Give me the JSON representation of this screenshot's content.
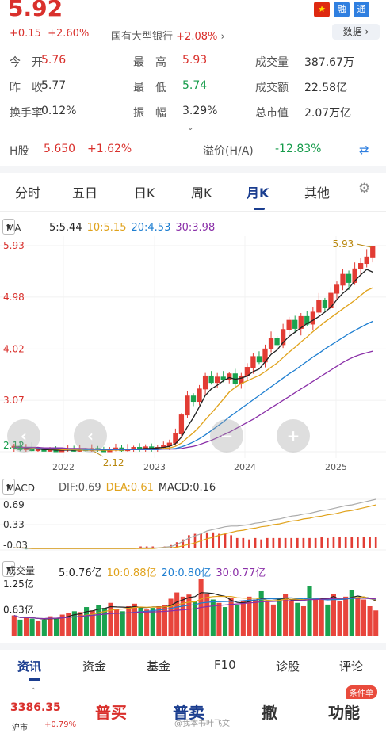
{
  "quote": {
    "price": "5.92",
    "change": "+0.15",
    "change_pct": "+2.60%",
    "sector_name": "国有大型银行",
    "sector_pct": "+2.08%",
    "badges": [
      "融",
      "通"
    ],
    "data_button": "数据"
  },
  "stats": [
    [
      {
        "label": "今　开",
        "value": "5.76",
        "color": "red"
      },
      {
        "label": "最　高",
        "value": "5.93",
        "color": "red"
      },
      {
        "label": "成交量",
        "value": "387.67万",
        "color": "grey"
      }
    ],
    [
      {
        "label": "昨　收",
        "value": "5.77",
        "color": "grey"
      },
      {
        "label": "最　低",
        "value": "5.74",
        "color": "green"
      },
      {
        "label": "成交额",
        "value": "22.58亿",
        "color": "grey"
      }
    ],
    [
      {
        "label": "换手率",
        "value": "0.12%",
        "color": "grey"
      },
      {
        "label": "振　幅",
        "value": "3.29%",
        "color": "grey"
      },
      {
        "label": "总市值",
        "value": "2.07万亿",
        "color": "grey"
      }
    ]
  ],
  "hshare": {
    "label": "H股",
    "price": "5.650",
    "pct": "+1.62%",
    "premium_label": "溢价(H/A)",
    "premium": "-12.83%"
  },
  "tabs": [
    "分时",
    "五日",
    "日K",
    "周K",
    "月K",
    "其他"
  ],
  "active_tab": "月K",
  "ma": {
    "selector": "MA",
    "items": [
      {
        "text": "5:5.44",
        "color": "#222222"
      },
      {
        "text": "10:5.15",
        "color": "#e0a21b"
      },
      {
        "text": "20:4.53",
        "color": "#1f7fd1"
      },
      {
        "text": "30:3.98",
        "color": "#8a2fa8"
      }
    ]
  },
  "chart_data": {
    "type": "candlestick",
    "interval": "monthly",
    "y_ticks": [
      "5.93",
      "4.98",
      "4.02",
      "3.07",
      "2.12"
    ],
    "ylim": [
      2.12,
      5.93
    ],
    "x_ticks": [
      "2022",
      "2023",
      "2024",
      "2025"
    ],
    "annotations": {
      "high": "5.93",
      "low": "2.12"
    },
    "zoom_controls": [
      "−",
      "+"
    ],
    "start_open": 2.2,
    "closes": [
      2.22,
      2.16,
      2.2,
      2.14,
      2.18,
      2.13,
      2.16,
      2.12,
      2.15,
      2.17,
      2.13,
      2.16,
      2.14,
      2.18,
      2.15,
      2.12,
      2.16,
      2.19,
      2.14,
      2.17,
      2.2,
      2.16,
      2.21,
      2.18,
      2.2,
      2.23,
      2.28,
      2.45,
      2.8,
      3.15,
      3.05,
      3.28,
      3.52,
      3.4,
      3.5,
      3.46,
      3.56,
      3.38,
      3.52,
      3.68,
      3.88,
      3.78,
      4.02,
      4.22,
      4.1,
      4.38,
      4.55,
      4.4,
      4.62,
      4.48,
      4.7,
      4.92,
      4.78,
      5.05,
      5.2,
      5.4,
      5.25,
      5.5,
      5.6,
      5.72,
      5.92
    ],
    "ma_lines": [
      {
        "name": "MA5",
        "color": "#222222",
        "values": [
          2.2,
          2.2,
          2.19,
          2.18,
          2.17,
          2.16,
          2.16,
          2.15,
          2.15,
          2.15,
          2.15,
          2.15,
          2.15,
          2.16,
          2.15,
          2.15,
          2.15,
          2.16,
          2.16,
          2.16,
          2.17,
          2.17,
          2.18,
          2.18,
          2.19,
          2.2,
          2.22,
          2.27,
          2.39,
          2.58,
          2.75,
          2.95,
          3.16,
          3.28,
          3.35,
          3.43,
          3.49,
          3.46,
          3.48,
          3.52,
          3.6,
          3.65,
          3.78,
          3.92,
          4.0,
          4.14,
          4.25,
          4.33,
          4.41,
          4.49,
          4.55,
          4.62,
          4.7,
          4.79,
          4.93,
          5.05,
          5.14,
          5.28,
          5.39,
          5.49,
          5.44
        ]
      },
      {
        "name": "MA10",
        "color": "#e0a21b",
        "values": [
          2.2,
          2.2,
          2.2,
          2.19,
          2.18,
          2.18,
          2.17,
          2.17,
          2.16,
          2.16,
          2.16,
          2.15,
          2.15,
          2.15,
          2.15,
          2.15,
          2.15,
          2.15,
          2.15,
          2.16,
          2.16,
          2.16,
          2.16,
          2.17,
          2.17,
          2.18,
          2.19,
          2.22,
          2.28,
          2.38,
          2.47,
          2.58,
          2.71,
          2.83,
          2.96,
          3.09,
          3.22,
          3.31,
          3.38,
          3.43,
          3.48,
          3.53,
          3.6,
          3.68,
          3.76,
          3.86,
          3.96,
          4.05,
          4.15,
          4.24,
          4.34,
          4.43,
          4.52,
          4.6,
          4.68,
          4.76,
          4.84,
          4.92,
          5.01,
          5.1,
          5.15
        ]
      },
      {
        "name": "MA20",
        "color": "#1f7fd1",
        "values": [
          2.2,
          2.2,
          2.2,
          2.2,
          2.19,
          2.19,
          2.19,
          2.18,
          2.18,
          2.17,
          2.17,
          2.17,
          2.16,
          2.16,
          2.16,
          2.16,
          2.16,
          2.16,
          2.16,
          2.16,
          2.16,
          2.16,
          2.16,
          2.16,
          2.16,
          2.17,
          2.17,
          2.18,
          2.21,
          2.25,
          2.3,
          2.36,
          2.43,
          2.51,
          2.59,
          2.67,
          2.76,
          2.84,
          2.92,
          3.0,
          3.08,
          3.16,
          3.24,
          3.32,
          3.4,
          3.48,
          3.56,
          3.63,
          3.71,
          3.79,
          3.87,
          3.94,
          4.02,
          4.09,
          4.16,
          4.23,
          4.3,
          4.36,
          4.42,
          4.48,
          4.53
        ]
      },
      {
        "name": "MA30",
        "color": "#8a2fa8",
        "values": [
          2.2,
          2.2,
          2.2,
          2.2,
          2.2,
          2.19,
          2.19,
          2.19,
          2.19,
          2.18,
          2.18,
          2.18,
          2.18,
          2.17,
          2.17,
          2.17,
          2.17,
          2.17,
          2.17,
          2.17,
          2.17,
          2.17,
          2.17,
          2.17,
          2.17,
          2.17,
          2.17,
          2.17,
          2.18,
          2.2,
          2.22,
          2.25,
          2.29,
          2.33,
          2.38,
          2.43,
          2.48,
          2.54,
          2.6,
          2.66,
          2.72,
          2.79,
          2.86,
          2.93,
          3.0,
          3.07,
          3.14,
          3.21,
          3.28,
          3.35,
          3.42,
          3.49,
          3.56,
          3.63,
          3.7,
          3.77,
          3.83,
          3.88,
          3.92,
          3.95,
          3.98
        ]
      }
    ]
  },
  "macd": {
    "selector": "MACD",
    "items": [
      {
        "text": "DIF:0.69",
        "color": "#555555"
      },
      {
        "text": "DEA:0.61",
        "color": "#e0a21b"
      },
      {
        "text": "MACD:0.16",
        "color": "#333333"
      }
    ],
    "y_ticks": [
      "0.69",
      "0.33",
      "-0.03"
    ],
    "ylim": [
      -0.03,
      0.69
    ],
    "dif": [
      0.0,
      0.0,
      -0.01,
      -0.01,
      -0.01,
      -0.01,
      -0.01,
      -0.01,
      -0.01,
      -0.01,
      -0.01,
      -0.01,
      -0.01,
      -0.01,
      -0.01,
      -0.01,
      -0.01,
      -0.01,
      -0.01,
      -0.01,
      -0.01,
      0.0,
      0.0,
      0.0,
      0.0,
      0.01,
      0.02,
      0.05,
      0.09,
      0.14,
      0.17,
      0.2,
      0.24,
      0.26,
      0.28,
      0.3,
      0.31,
      0.31,
      0.32,
      0.33,
      0.35,
      0.36,
      0.38,
      0.4,
      0.41,
      0.43,
      0.45,
      0.46,
      0.48,
      0.49,
      0.51,
      0.53,
      0.54,
      0.56,
      0.58,
      0.6,
      0.61,
      0.63,
      0.65,
      0.67,
      0.69
    ],
    "dea": [
      0.0,
      0.0,
      0.0,
      -0.01,
      -0.01,
      -0.01,
      -0.01,
      -0.01,
      -0.01,
      -0.01,
      -0.01,
      -0.01,
      -0.01,
      -0.01,
      -0.01,
      -0.01,
      -0.01,
      -0.01,
      -0.01,
      -0.01,
      -0.01,
      -0.01,
      -0.01,
      -0.01,
      0.0,
      0.0,
      0.0,
      0.01,
      0.03,
      0.05,
      0.07,
      0.1,
      0.13,
      0.15,
      0.18,
      0.2,
      0.22,
      0.24,
      0.25,
      0.27,
      0.28,
      0.3,
      0.31,
      0.33,
      0.34,
      0.36,
      0.38,
      0.39,
      0.41,
      0.42,
      0.44,
      0.45,
      0.47,
      0.48,
      0.5,
      0.52,
      0.53,
      0.55,
      0.57,
      0.59,
      0.61
    ]
  },
  "volume": {
    "selector": "成交量",
    "items": [
      {
        "text": "5:0.76亿",
        "color": "#222222"
      },
      {
        "text": "10:0.88亿",
        "color": "#e0a21b"
      },
      {
        "text": "20:0.80亿",
        "color": "#1f7fd1"
      },
      {
        "text": "30:0.77亿",
        "color": "#8a2fa8"
      }
    ],
    "y_ticks": [
      "1.25亿",
      "0.63亿"
    ],
    "ylim": [
      0,
      1.25
    ],
    "values": [
      0.5,
      0.4,
      0.45,
      0.42,
      0.38,
      0.4,
      0.48,
      0.44,
      0.52,
      0.55,
      0.6,
      0.58,
      0.7,
      0.62,
      0.75,
      0.68,
      0.8,
      0.66,
      0.6,
      0.72,
      0.78,
      0.7,
      0.64,
      0.68,
      0.72,
      0.75,
      0.9,
      1.05,
      0.95,
      1.0,
      0.85,
      1.38,
      1.02,
      0.88,
      0.8,
      0.7,
      0.92,
      0.75,
      0.84,
      0.95,
      0.88,
      1.08,
      0.82,
      0.76,
      0.9,
      1.02,
      0.86,
      0.8,
      0.72,
      1.2,
      0.92,
      0.88,
      0.76,
      1.02,
      0.84,
      0.95,
      1.1,
      0.92,
      0.88,
      0.72,
      0.62
    ]
  },
  "bottom_tabs": [
    "资讯",
    "资金",
    "基金",
    "F10",
    "诊股",
    "评论"
  ],
  "bottom_active": "资讯",
  "bottom_bar": {
    "index_value": "3386.35",
    "index_name": "沪市",
    "index_pct": "+0.79%",
    "buy": "普买",
    "sell": "普卖",
    "cancel": "撤",
    "func": "功能",
    "cond": "条件单"
  },
  "watermark": "@我本书叶飞文"
}
